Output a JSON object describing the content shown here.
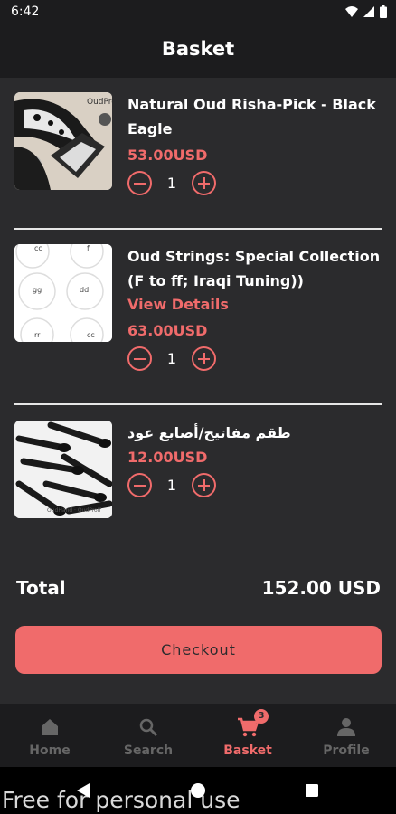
{
  "status": {
    "time": "6:42"
  },
  "header": {
    "title": "Basket"
  },
  "items": [
    {
      "name": "Natural Oud Risha-Pick - Black Eagle",
      "price": "53.00USD",
      "qty": "1"
    },
    {
      "name": "Oud Strings: Special Collection (F to ff; Iraqi Tuning))",
      "link": "View Details",
      "price": "63.00USD",
      "qty": "1"
    },
    {
      "name": "طقم مفاتيح/أصابع عود",
      "price": "12.00USD",
      "qty": "1"
    }
  ],
  "thumb_text": {
    "item1_brand": "OudProff",
    "item2_labels": [
      "cc",
      "f",
      "gg",
      "dd",
      "rr",
      "cc"
    ],
    "item3_brand": "OudHand · OudProff"
  },
  "total": {
    "label": "Total",
    "value": "152.00 USD"
  },
  "checkout_label": "Checkout",
  "tabs": [
    {
      "label": "Home",
      "icon": "home-icon"
    },
    {
      "label": "Search",
      "icon": "search-icon"
    },
    {
      "label": "Basket",
      "icon": "cart-icon",
      "badge": "3",
      "active": true
    },
    {
      "label": "Profile",
      "icon": "person-icon"
    }
  ],
  "watermark": "Free for personal use",
  "colors": {
    "accent": "#f06b6b",
    "background": "#2b2b2d",
    "bar": "#1c1c1e"
  }
}
